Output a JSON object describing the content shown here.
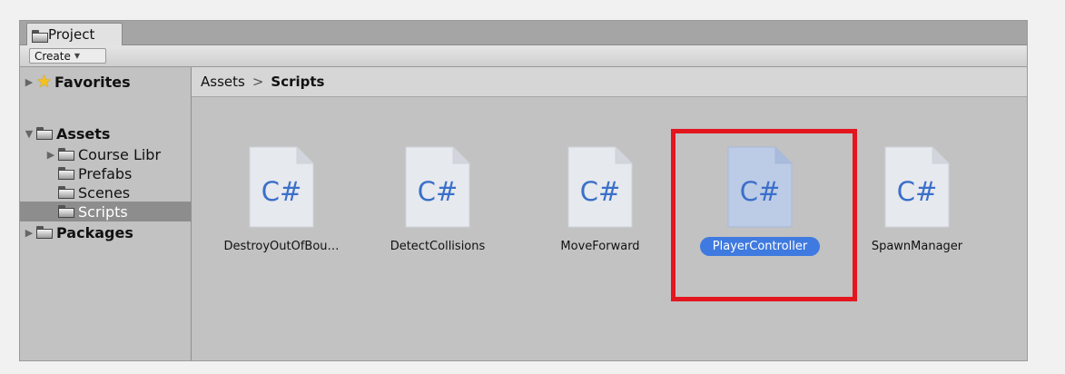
{
  "window": {
    "tab_label": "Project",
    "create_label": "Create"
  },
  "sidebar": {
    "favorites": "Favorites",
    "assets": "Assets",
    "course_library": "Course Libr",
    "prefabs": "Prefabs",
    "scenes": "Scenes",
    "scripts": "Scripts",
    "packages": "Packages"
  },
  "breadcrumb": {
    "root": "Assets",
    "separator": ">",
    "current": "Scripts"
  },
  "assets": [
    {
      "label": "DestroyOutOfBou…",
      "icon_text": "C#",
      "selected": false
    },
    {
      "label": "DetectCollisions",
      "icon_text": "C#",
      "selected": false
    },
    {
      "label": "MoveForward",
      "icon_text": "C#",
      "selected": false
    },
    {
      "label": "PlayerController",
      "icon_text": "C#",
      "selected": true
    },
    {
      "label": "SpawnManager",
      "icon_text": "C#",
      "selected": false
    }
  ],
  "colors": {
    "selection": "#3f7ae0",
    "highlight_box": "#e3161e",
    "csharp_text": "#3a6fc9"
  }
}
